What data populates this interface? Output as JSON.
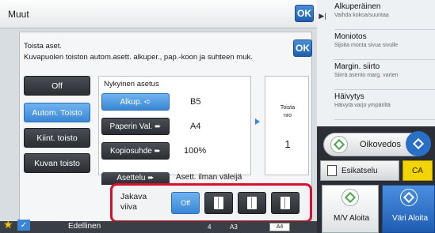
{
  "titlebar": {
    "title": "Muut",
    "ok_label": "OK"
  },
  "sidebar": {
    "items": [
      {
        "main": "Alkuperäinen",
        "sub": "Vaihda kokoa/suuntaa"
      },
      {
        "main": "Moniotos",
        "sub": "Sijoita monta sivua sivulle"
      },
      {
        "main": "Margin. siirto",
        "sub": "Siirrä asento marg. varten"
      },
      {
        "main": "Häivytys",
        "sub": "Häivytä varjo ympäriltä"
      }
    ]
  },
  "panel": {
    "title": "Toista aset.",
    "description": "Kuvapuolen toiston autom.asett. alkuper., pap.-koon ja suhteen muk.",
    "ok_label": "OK"
  },
  "options": [
    {
      "label": "Off",
      "active": false
    },
    {
      "label": "Autom. Toisto",
      "active": true
    },
    {
      "label": "Kiint. toisto",
      "active": false
    },
    {
      "label": "Kuvan toisto",
      "active": false
    }
  ],
  "settings": {
    "header": "Nykyinen asetus",
    "rows": [
      {
        "label": "Alkup.",
        "value": "B5"
      },
      {
        "label": "Paperin Val.",
        "value": "A4"
      },
      {
        "label": "Kopiosuhde",
        "value": "100%"
      }
    ]
  },
  "print_count": {
    "label1": "Toista",
    "label2": "nro",
    "value": "1"
  },
  "asettelu": {
    "label": "Asettelu",
    "value": "Asett. ilman väleijä"
  },
  "jakava": {
    "label": "Jakava viiva",
    "off_label": "Off"
  },
  "right_panel": {
    "oikovedos": "Oikovedos",
    "esikatselu": "Esikatselu",
    "ca": "CA",
    "start_mv": "M/V Aloita",
    "start_color": "Väri Aloita"
  },
  "bottom": {
    "edellinen": "Edellinen",
    "t1": "4",
    "t2": "A3",
    "t3": "A4"
  }
}
